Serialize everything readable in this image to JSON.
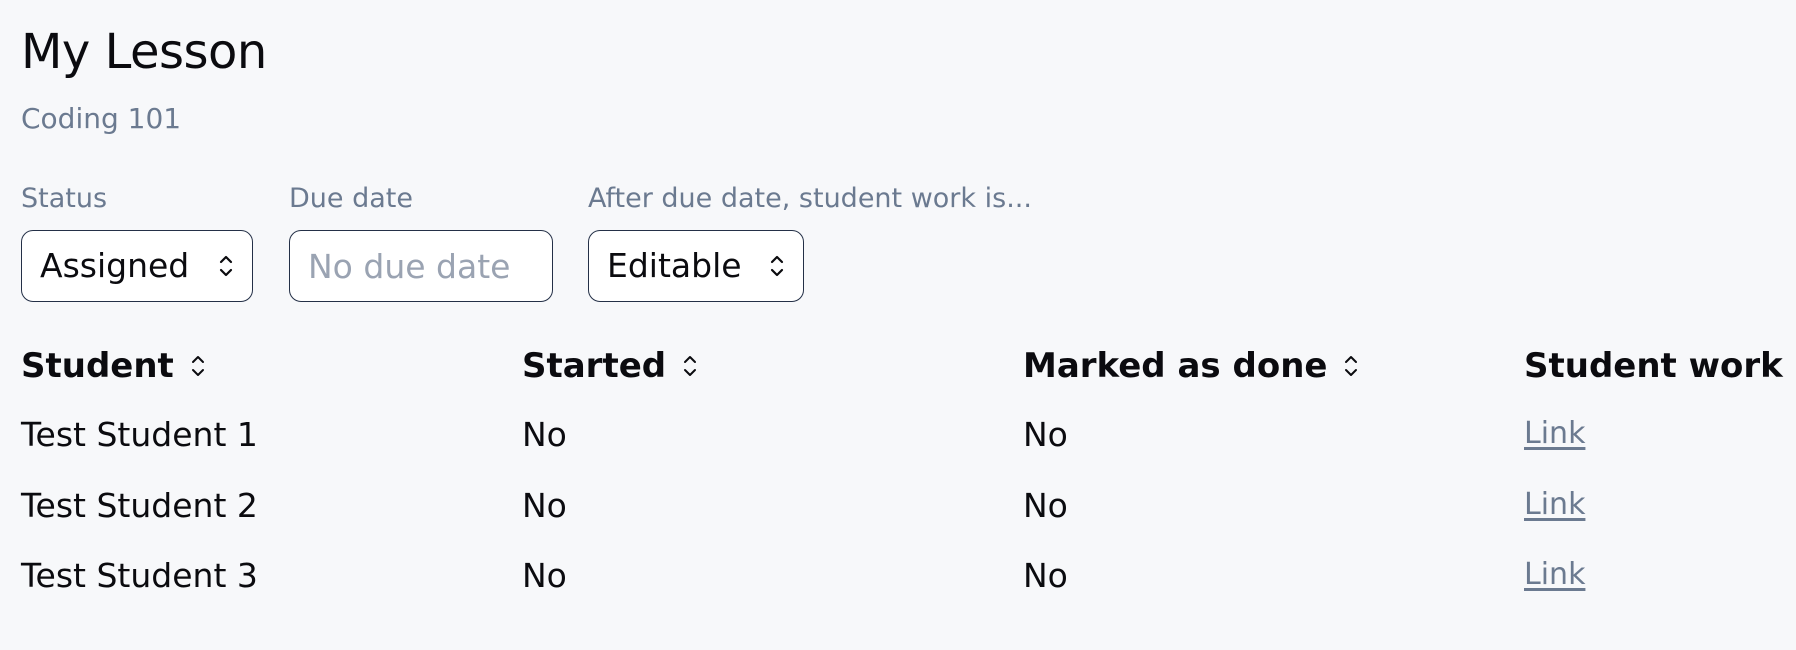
{
  "header": {
    "title": "My Lesson",
    "subtitle": "Coding 101"
  },
  "filters": {
    "status": {
      "label": "Status",
      "value": "Assigned",
      "icon": "updown-chevron-icon"
    },
    "due_date": {
      "label": "Due date",
      "placeholder": "No due date",
      "value": ""
    },
    "after_due": {
      "label": "After due date, student work is...",
      "value": "Editable",
      "icon": "updown-chevron-icon"
    }
  },
  "table": {
    "columns": [
      {
        "label": "Student",
        "sortable": true
      },
      {
        "label": "Started",
        "sortable": true
      },
      {
        "label": "Marked as done",
        "sortable": true
      },
      {
        "label": "Student work",
        "sortable": false
      }
    ],
    "rows": [
      {
        "student": "Test Student 1",
        "started": "No",
        "done": "No",
        "work": "Link"
      },
      {
        "student": "Test Student 2",
        "started": "No",
        "done": "No",
        "work": "Link"
      },
      {
        "student": "Test Student 3",
        "started": "No",
        "done": "No",
        "work": "Link"
      }
    ]
  },
  "colors": {
    "background": "#f7f8fa",
    "muted_text": "#6b7a90",
    "border": "#243047",
    "placeholder": "#9aa3b2"
  }
}
